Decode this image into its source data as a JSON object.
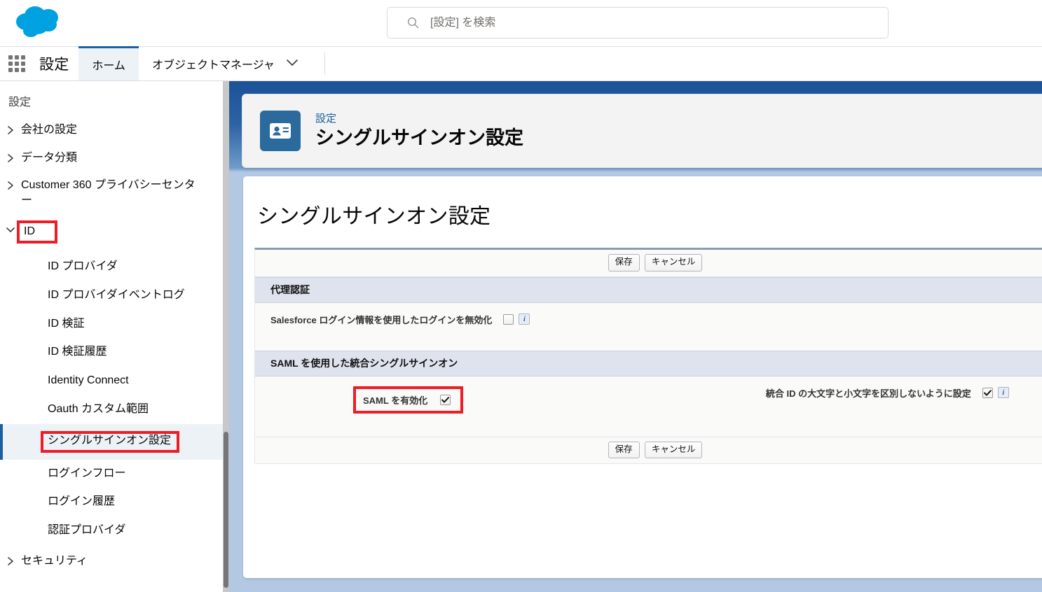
{
  "header": {
    "logo_name": "salesforce-cloud-logo",
    "search": {
      "placeholder": "[設定] を検索",
      "value": "",
      "icon": "search-icon"
    }
  },
  "app_nav": {
    "launcher_icon": "app-launcher-icon",
    "app_name": "設定",
    "tabs": [
      {
        "label": "ホーム",
        "active": true
      },
      {
        "label": "オブジェクトマネージャ",
        "active": false,
        "caret": "chevron-down-icon"
      }
    ]
  },
  "sidebar": {
    "title": "設定",
    "items": [
      {
        "label": "会社の設定",
        "level": "top",
        "expanded": false,
        "chevron": "chevron-right-icon"
      },
      {
        "label": "データ分類",
        "level": "top",
        "expanded": false,
        "chevron": "chevron-right-icon"
      },
      {
        "label": "Customer 360 プライバシーセンター",
        "level": "top",
        "expanded": false,
        "chevron": "chevron-right-icon"
      },
      {
        "label": "ID",
        "level": "top",
        "expanded": true,
        "chevron": "chevron-down-icon",
        "highlighted": true
      },
      {
        "label": "ID プロバイダ",
        "level": "child"
      },
      {
        "label": "ID プロバイダイベントログ",
        "level": "child"
      },
      {
        "label": "ID 検証",
        "level": "child"
      },
      {
        "label": "ID 検証履歴",
        "level": "child"
      },
      {
        "label": "Identity Connect",
        "level": "child"
      },
      {
        "label": "Oauth カスタム範囲",
        "level": "child"
      },
      {
        "label": "シングルサインオン設定",
        "level": "child",
        "selected": true,
        "highlighted": true
      },
      {
        "label": "ログインフロー",
        "level": "child"
      },
      {
        "label": "ログイン履歴",
        "level": "child"
      },
      {
        "label": "認証プロバイダ",
        "level": "child"
      },
      {
        "label": "セキュリティ",
        "level": "top",
        "expanded": false,
        "chevron": "chevron-right-icon"
      }
    ]
  },
  "page_header": {
    "icon": "id-card-icon",
    "eyebrow": "設定",
    "title": "シングルサインオン設定"
  },
  "main": {
    "title": "シングルサインオン設定",
    "buttons": {
      "save": "保存",
      "cancel": "キャンセル"
    },
    "sections": [
      {
        "heading": "代理認証",
        "fields": [
          {
            "label": "Salesforce ログイン情報を使用したログインを無効化",
            "checked": false,
            "info": "i",
            "highlighted": false
          }
        ]
      },
      {
        "heading": "SAML を使用した統合シングルサインオン",
        "fields": [
          {
            "label": "SAML を有効化",
            "checked": true,
            "info": null,
            "highlighted": true
          },
          {
            "label": "統合 ID の大文字と小文字を区別しないように設定",
            "checked": true,
            "info": "i",
            "highlighted": false
          }
        ]
      }
    ]
  },
  "colors": {
    "brand_blue": "#1b5f9e",
    "cloud_blue": "#00a1e0",
    "header_icon_bg": "#2b6a9c",
    "highlight_red": "#ee1c25",
    "section_head_bg": "#dfe3ee",
    "selected_nav_bg": "#ecf2f6"
  }
}
